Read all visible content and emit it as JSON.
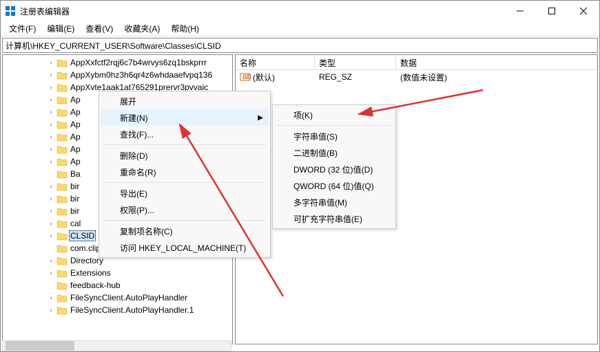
{
  "window": {
    "title": "注册表编辑器"
  },
  "menu": {
    "file": "文件(F)",
    "edit": "编辑(E)",
    "view": "查看(V)",
    "fav": "收藏夹(A)",
    "help": "帮助(H)"
  },
  "path": "计算机\\HKEY_CURRENT_USER\\Software\\Classes\\CLSID",
  "tree": [
    {
      "label": "AppXxfctf2rqj6c7b4wrvys6zq1bskprrr",
      "exp": true
    },
    {
      "label": "AppXybm0hz3h6qr4z6whdaaefvpq136",
      "exp": true
    },
    {
      "label": "AppXvte1aak1at765291prervr3pvvaic",
      "exp": true
    },
    {
      "label": "Ap",
      "exp": true
    },
    {
      "label": "Ap",
      "exp": true
    },
    {
      "label": "Ap",
      "exp": true
    },
    {
      "label": "Ap",
      "exp": true
    },
    {
      "label": "Ap",
      "exp": true
    },
    {
      "label": "Ap",
      "exp": true
    },
    {
      "label": "Ba",
      "exp": false
    },
    {
      "label": "bir",
      "exp": true
    },
    {
      "label": "bir",
      "exp": true
    },
    {
      "label": "bir",
      "exp": true
    },
    {
      "label": "cal",
      "exp": true
    },
    {
      "label": "CLSID",
      "exp": true,
      "sel": true
    },
    {
      "label": "com.clipchamp.app",
      "exp": false
    },
    {
      "label": "Directory",
      "exp": true
    },
    {
      "label": "Extensions",
      "exp": true
    },
    {
      "label": "feedback-hub",
      "exp": false
    },
    {
      "label": "FileSyncClient.AutoPlayHandler",
      "exp": true
    },
    {
      "label": "FileSyncClient.AutoPlayHandler.1",
      "exp": true
    }
  ],
  "list": {
    "headers": {
      "name": "名称",
      "type": "类型",
      "data": "数据"
    },
    "rows": [
      {
        "name": "(默认)",
        "type": "REG_SZ",
        "data": "(数值未设置)"
      }
    ]
  },
  "ctx1": {
    "expand": "展开",
    "new": "新建(N)",
    "find": "查找(F)...",
    "delete": "删除(D)",
    "rename": "重命名(R)",
    "export": "导出(E)",
    "perm": "权限(P)...",
    "copyname": "复制项名称(C)",
    "visit": "访问 HKEY_LOCAL_MACHINE(T)"
  },
  "ctx2": {
    "key": "项(K)",
    "string": "字符串值(S)",
    "binary": "二进制值(B)",
    "dword": "DWORD (32 位)值(D)",
    "qword": "QWORD (64 位)值(Q)",
    "multi": "多字符串值(M)",
    "expand": "可扩充字符串值(E)"
  }
}
